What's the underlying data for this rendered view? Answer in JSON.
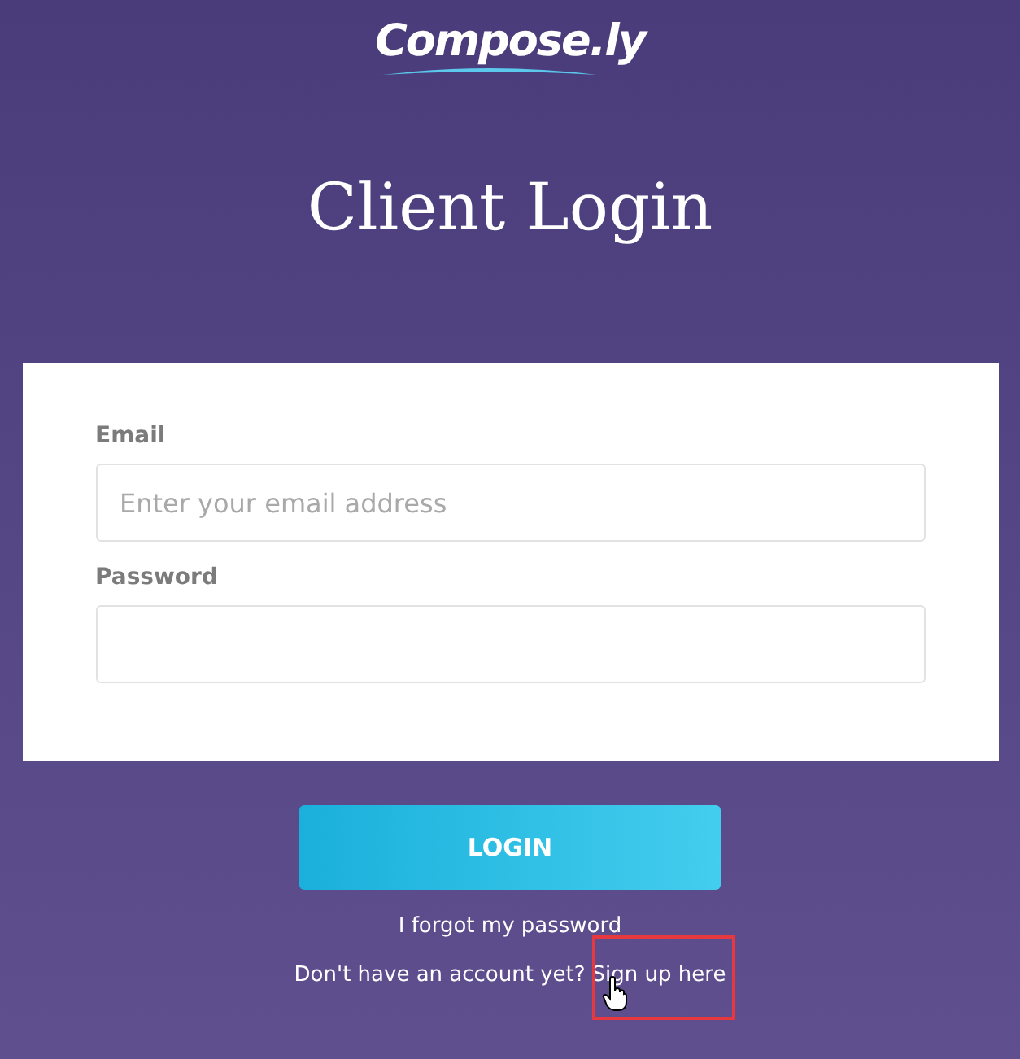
{
  "logo": "Compose.ly",
  "title": "Client Login",
  "fields": [
    {
      "label": "Email",
      "placeholder": "Enter your email address"
    },
    {
      "label": "Password"
    }
  ],
  "login_button": "LOGIN",
  "forgot_link": "I forgot my password",
  "signup_prompt": "Don't have an account yet?",
  "signup_link": "Sign up here"
}
